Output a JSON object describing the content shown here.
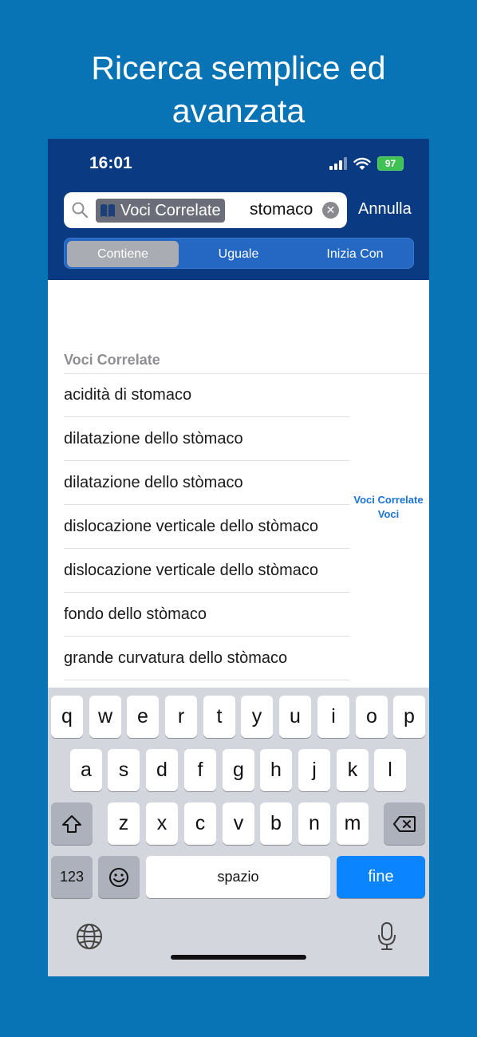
{
  "headline": {
    "line1": "Ricerca semplice ed",
    "line2": "avanzata"
  },
  "status": {
    "time": "16:01",
    "battery": "97"
  },
  "search": {
    "token_label": "Voci Correlate",
    "query": "stomaco",
    "cancel_label": "Annulla",
    "clear_icon": "clear-icon"
  },
  "segments": [
    {
      "label": "Contiene",
      "active": true
    },
    {
      "label": "Uguale",
      "active": false
    },
    {
      "label": "Inizia Con",
      "active": false
    }
  ],
  "section": {
    "title": "Voci Correlate"
  },
  "results": [
    "acidità di stomaco",
    "dilatazione dello stòmaco",
    "dilatazione dello stòmaco",
    "dislocazione verticale dello stòmaco",
    "dislocazione verticale dello stòmaco",
    "fondo dello stòmaco",
    "grande curvatura dello stòmaco"
  ],
  "index": [
    "Voci Correlate",
    "Voci"
  ],
  "keyboard": {
    "row1": [
      "q",
      "w",
      "e",
      "r",
      "t",
      "y",
      "u",
      "i",
      "o",
      "p"
    ],
    "row2": [
      "a",
      "s",
      "d",
      "f",
      "g",
      "h",
      "j",
      "k",
      "l"
    ],
    "row3": [
      "z",
      "x",
      "c",
      "v",
      "b",
      "n",
      "m"
    ],
    "numbers_label": "123",
    "space_label": "spazio",
    "done_label": "fine"
  },
  "colors": {
    "background": "#0874b6",
    "navbar": "#0a3a82",
    "accent": "#0b84ff"
  }
}
